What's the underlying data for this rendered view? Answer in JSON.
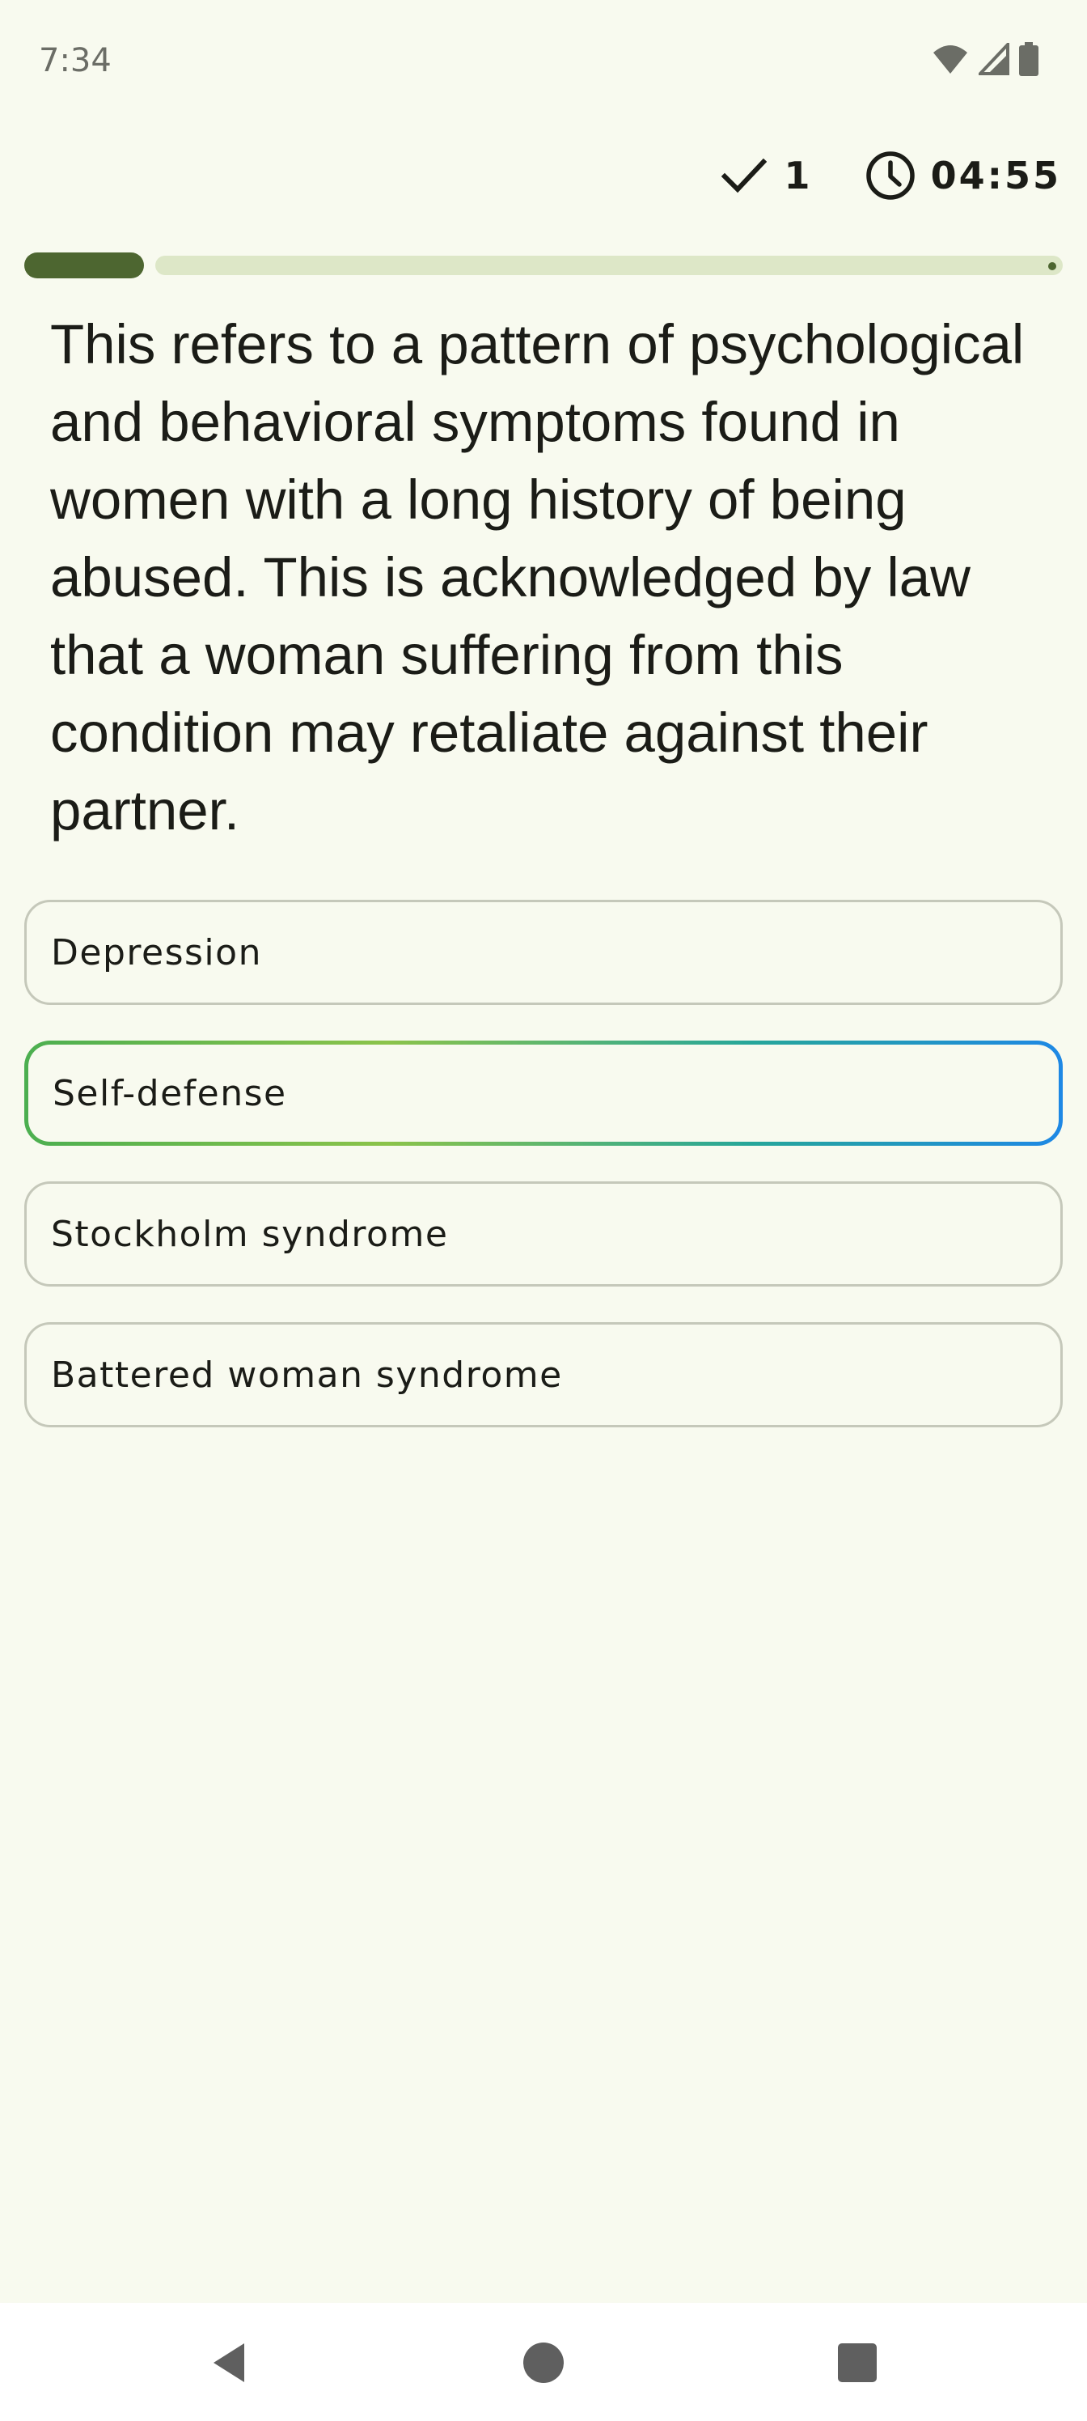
{
  "status_bar": {
    "time": "7:34",
    "icons": [
      "wifi-icon",
      "signal-icon",
      "battery-icon"
    ]
  },
  "header": {
    "score_icon": "check-icon",
    "score": "1",
    "timer_icon": "clock-icon",
    "timer": "04:55"
  },
  "progress": {
    "fraction": 0.115
  },
  "question": {
    "text": "This refers to a pattern of psychological and behavioral symptoms found in women with a long history of being abused. This is acknowledged by law that a woman suffering from this condition may retaliate against their partner."
  },
  "options": [
    {
      "label": "Depression",
      "selected": false
    },
    {
      "label": "Self-defense",
      "selected": true
    },
    {
      "label": "Stockholm syndrome",
      "selected": false
    },
    {
      "label": "Battered woman syndrome",
      "selected": false
    }
  ],
  "navigation": {
    "icons": [
      "back-icon",
      "home-icon",
      "recents-icon"
    ]
  },
  "colors": {
    "background": "#f8faef",
    "progress_fill": "#4d6630",
    "progress_track": "#dde7c7",
    "selected_gradient_start": "#4caf50",
    "selected_gradient_end": "#1e88e5"
  }
}
